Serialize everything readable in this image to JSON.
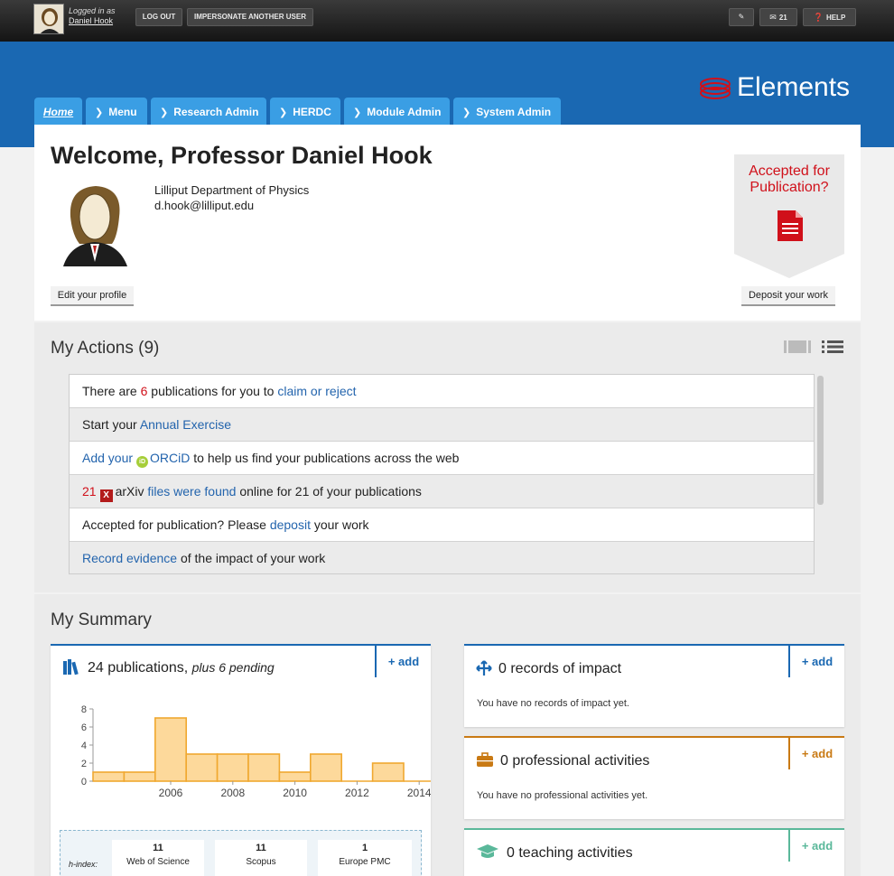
{
  "topbar": {
    "logged_in_as": "Logged in as",
    "user_name": "Daniel Hook",
    "logout": "LOG OUT",
    "impersonate": "IMPERSONATE ANOTHER USER",
    "messages_count": "21",
    "help": "HELP"
  },
  "brand": {
    "name": "Elements",
    "color": "#d0101a"
  },
  "nav": {
    "tabs": [
      {
        "label": "Home"
      },
      {
        "label": "Menu"
      },
      {
        "label": "Research Admin"
      },
      {
        "label": "HERDC"
      },
      {
        "label": "Module Admin"
      },
      {
        "label": "System Admin"
      }
    ]
  },
  "welcome": {
    "title": "Welcome, Professor Daniel Hook",
    "department": "Lilliput Department of Physics",
    "email": "d.hook@lilliput.edu",
    "edit_profile": "Edit your profile",
    "accepted_line1": "Accepted for",
    "accepted_line2": "Publication?",
    "deposit": "Deposit your work"
  },
  "actions": {
    "title": "My Actions (9)",
    "rows": {
      "r1_pre": "There are ",
      "r1_count": "6",
      "r1_mid": " publications for you to ",
      "r1_link": "claim or reject",
      "r2_pre": "Start your ",
      "r2_link": "Annual Exercise",
      "r3_link": "Add your",
      "r3_orcid": "ORCiD",
      "r3_post": " to help us find your publications across the web",
      "r4_count": "21",
      "r4_src": "arXiv ",
      "r4_link": "files were found",
      "r4_post": " online for 21 of your publications",
      "r5_pre": "Accepted for publication? Please ",
      "r5_link": "deposit",
      "r5_post": " your work",
      "r6_link": "Record evidence",
      "r6_post": " of the impact of your work"
    }
  },
  "summary": {
    "title": "My Summary",
    "add_label": "+ add",
    "publications": {
      "count_label": "24 publications,",
      "pending": "plus 6 pending"
    },
    "impact": {
      "title": "0 records of impact",
      "note": "You have no records of impact yet."
    },
    "professional": {
      "title": "0 professional activities",
      "note": "You have no professional activities yet."
    },
    "teaching": {
      "title": "0 teaching activities"
    },
    "hindex": {
      "label": "h-index:",
      "sources": [
        {
          "value": "11",
          "name": "Web of Science"
        },
        {
          "value": "11",
          "name": "Scopus"
        },
        {
          "value": "1",
          "name": "Europe PMC"
        }
      ]
    },
    "colors": {
      "impact": "#1a68b2",
      "professional": "#c97a14",
      "teaching": "#5ab89a",
      "publications": "#1a68b2"
    }
  },
  "chart_data": {
    "type": "bar",
    "x": [
      2004,
      2005,
      2006,
      2007,
      2008,
      2009,
      2010,
      2011,
      2012,
      2013,
      2014
    ],
    "values": [
      1,
      1,
      7,
      3,
      3,
      3,
      1,
      3,
      0,
      2,
      0
    ],
    "xticks": [
      "2006",
      "2008",
      "2010",
      "2012",
      "2014"
    ],
    "yticks": [
      "0",
      "2",
      "4",
      "6",
      "8"
    ],
    "ylim": [
      0,
      8
    ],
    "bar_color": "#fdd99b",
    "bar_edge": "#f0a830"
  }
}
